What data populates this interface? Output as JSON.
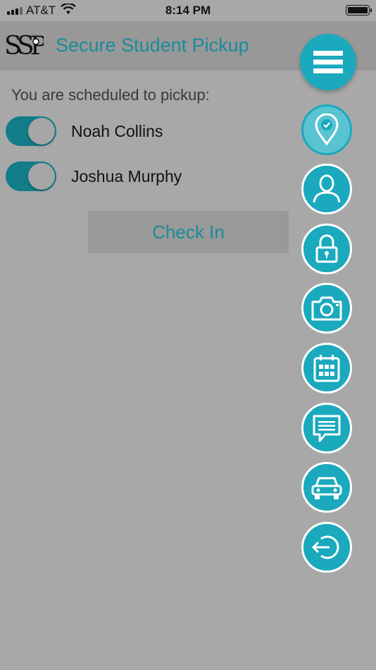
{
  "status_bar": {
    "carrier": "AT&T",
    "time": "8:14 PM"
  },
  "header": {
    "logo_text": "SSP",
    "title": "Secure Student Pickup"
  },
  "main": {
    "prompt": "You are scheduled to pickup:",
    "students": [
      {
        "name": "Noah Collins",
        "selected": true
      },
      {
        "name": "Joshua Murphy",
        "selected": true
      }
    ],
    "checkin_label": "Check In"
  },
  "fab_menu": {
    "items": [
      {
        "icon": "hamburger-menu-icon"
      },
      {
        "icon": "location-check-icon",
        "active": true
      },
      {
        "icon": "person-icon"
      },
      {
        "icon": "lock-icon"
      },
      {
        "icon": "camera-icon"
      },
      {
        "icon": "calendar-icon"
      },
      {
        "icon": "message-icon"
      },
      {
        "icon": "car-icon"
      },
      {
        "icon": "logout-icon"
      }
    ]
  },
  "colors": {
    "accent": "#1aa9bd",
    "toggle_on": "#127c89",
    "title_text": "#1a8c9b",
    "background": "#a8a8a8"
  }
}
